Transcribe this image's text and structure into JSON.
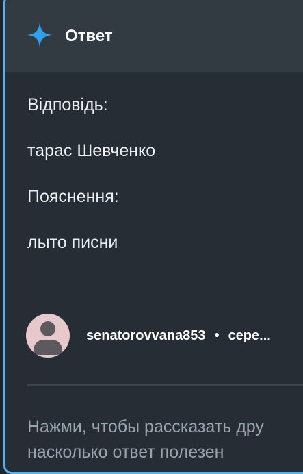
{
  "header": {
    "icon": "sparkle-star-icon",
    "accent_color": "#2f9ff0",
    "title": "Ответ"
  },
  "answer": {
    "answer_label": "Відповідь:",
    "answer_text": "тарас Шевченко",
    "explanation_label": "Пояснення:",
    "explanation_text": "лыто писни"
  },
  "author": {
    "avatar_icon": "user-avatar-icon",
    "username": "senatorovvana853",
    "separator": "•",
    "date": "сере..."
  },
  "feedback": {
    "line1": "Нажми, чтобы рассказать дру",
    "line2": "насколько ответ полезен"
  }
}
